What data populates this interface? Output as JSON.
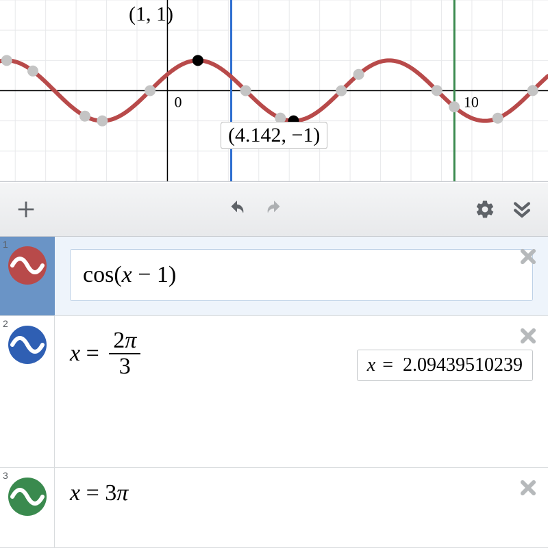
{
  "chart_data": {
    "type": "line",
    "title": "",
    "xlabel": "",
    "ylabel": "",
    "xlim": [
      -5.5,
      12.5
    ],
    "ylim": [
      -3,
      3
    ],
    "series": [
      {
        "name": "cos(x-1)",
        "type": "cos",
        "phase": 1,
        "amplitude": 1,
        "center_y": 0,
        "color": "#b84a4a"
      },
      {
        "name": "x=2π/3",
        "type": "vline",
        "x": 2.09439510239,
        "color": "#2f6fd1"
      },
      {
        "name": "x=3π",
        "type": "vline",
        "x": 9.42477796077,
        "color": "#3a8a4e"
      }
    ],
    "axis_ticks_x": [
      0,
      10
    ],
    "gray_points_x": [
      -5.28,
      -4.42,
      -2.71,
      -2.14,
      -0.57,
      1.0,
      2.57,
      3.71,
      5.71,
      6.28,
      8.85,
      9.42,
      10.85,
      12.0
    ],
    "black_points": [
      {
        "x": 1.0,
        "y": 1.0
      },
      {
        "x": 4.142,
        "y": -1.0
      }
    ],
    "labels": [
      {
        "text": "(1, 1)",
        "x": 1.0,
        "y": 1.0,
        "pos": "top"
      },
      {
        "text": "(4.142, −1)",
        "x": 4.142,
        "y": -1.0,
        "pos": "bottom"
      }
    ],
    "origin_label": "0"
  },
  "toolbar": {
    "add_label": "+"
  },
  "rows": [
    {
      "index": "1",
      "color": "#b84a4a",
      "selected": true,
      "expr_html": "<span class='rm'>cos</span><span class='rm'>(</span><span>x</span><span class='rm'>&nbsp;−&nbsp;1</span><span class='rm'>)</span>"
    },
    {
      "index": "2",
      "color": "#2f5fb3",
      "selected": false,
      "expr_html": "<span>x</span><span class='rm'>&nbsp;=&nbsp;</span><span class='frac'><span class='num'>2<span style=\"font-style:italic\">π</span></span><span class='den'>3</span></span>",
      "result_var": "x",
      "result_val": "2.09439510239"
    },
    {
      "index": "3",
      "color": "#3a8a4e",
      "selected": false,
      "expr_html": "<span>x</span><span class='rm'>&nbsp;=&nbsp;3</span><span>π</span>"
    }
  ],
  "labels": {
    "point_top": "(1, 1)",
    "point_bottom": "(4.142, −1)"
  }
}
